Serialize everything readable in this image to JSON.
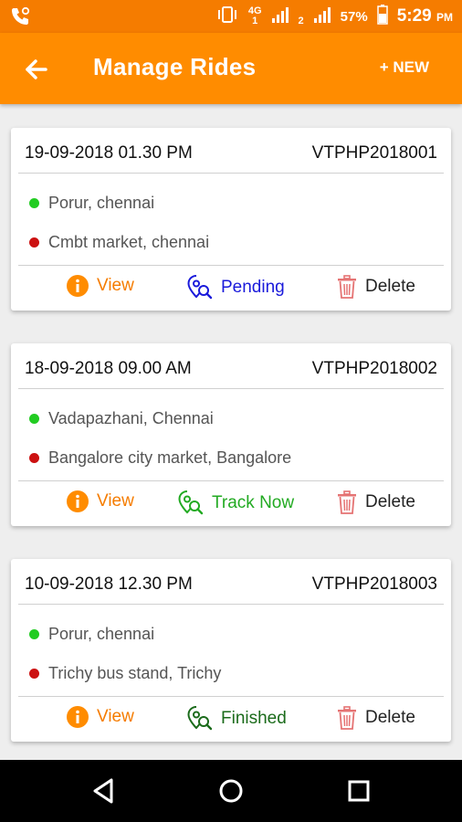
{
  "status_bar": {
    "net_type": "4G",
    "sim1": "1",
    "sim2": "2",
    "battery": "57%",
    "time": "5:29",
    "ampm": "PM"
  },
  "app_bar": {
    "title": "Manage Rides",
    "new_label": "+ NEW"
  },
  "rides": [
    {
      "datetime": "19-09-2018 01.30 PM",
      "id": "VTPHP2018001",
      "from": "Porur, chennai",
      "to": "Cmbt market, chennai",
      "view_label": "View",
      "status_label": "Pending",
      "status_color": "#1a1adb",
      "delete_label": "Delete"
    },
    {
      "datetime": "18-09-2018 09.00 AM",
      "id": "VTPHP2018002",
      "from": "Vadapazhani, Chennai",
      "to": "Bangalore city market, Bangalore",
      "view_label": "View",
      "status_label": "Track Now",
      "status_color": "#22aa22",
      "delete_label": "Delete"
    },
    {
      "datetime": "10-09-2018 12.30 PM",
      "id": "VTPHP2018003",
      "from": "Porur, chennai",
      "to": "Trichy bus stand, Trichy",
      "view_label": "View",
      "status_label": "Finished",
      "status_color": "#1b6b1b",
      "delete_label": "Delete"
    }
  ],
  "colors": {
    "accent": "#ff8c00",
    "from_dot": "#22cc22",
    "to_dot": "#cc1111",
    "delete_icon": "#e57373"
  },
  "icons": {
    "back": "arrow-left-icon",
    "view": "info-icon",
    "status": "location-search-icon",
    "delete": "trash-icon",
    "nav_back": "triangle-back-icon",
    "nav_home": "circle-home-icon",
    "nav_recents": "square-recents-icon"
  }
}
